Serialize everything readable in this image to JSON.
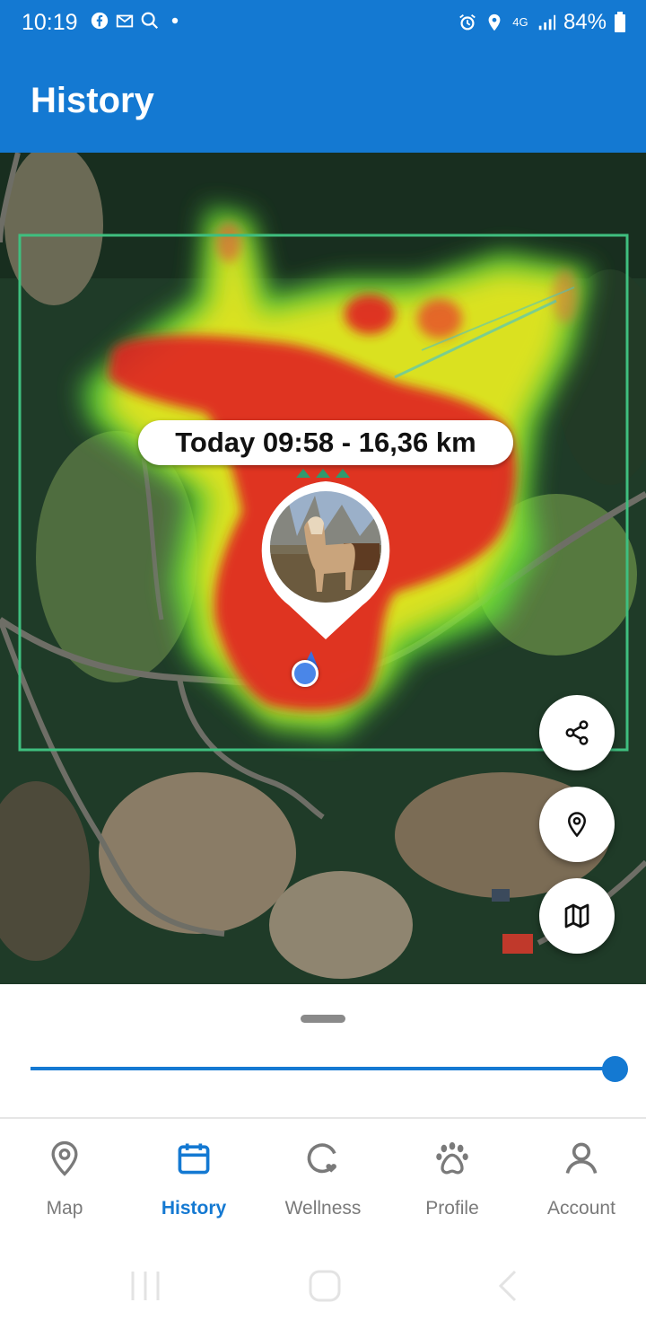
{
  "status_bar": {
    "time": "10:19",
    "battery": "84%",
    "network": "4G",
    "icons": [
      "facebook-icon",
      "gmail-icon",
      "search-icon",
      "dot-icon",
      "alarm-icon",
      "location-icon",
      "signal-icon",
      "battery-icon"
    ]
  },
  "app_bar": {
    "title": "History"
  },
  "map": {
    "trip_label": "Today 09:58 - 16,36 km",
    "heatmap_colors": {
      "high": "#e02424",
      "mid": "#f2e61a",
      "low": "#5ee03a"
    },
    "fab_buttons": [
      "share-icon",
      "location-pin-icon",
      "map-icon"
    ]
  },
  "timeline": {
    "slider_value_percent": 100
  },
  "bottom_nav": {
    "items": [
      {
        "label": "Map",
        "icon": "map-pin-icon",
        "active": false
      },
      {
        "label": "History",
        "icon": "calendar-icon",
        "active": true
      },
      {
        "label": "Wellness",
        "icon": "wellness-icon",
        "active": false
      },
      {
        "label": "Profile",
        "icon": "paw-icon",
        "active": false
      },
      {
        "label": "Account",
        "icon": "user-icon",
        "active": false
      }
    ]
  },
  "colors": {
    "primary": "#1479d2",
    "inactive": "#7a7a7a"
  }
}
